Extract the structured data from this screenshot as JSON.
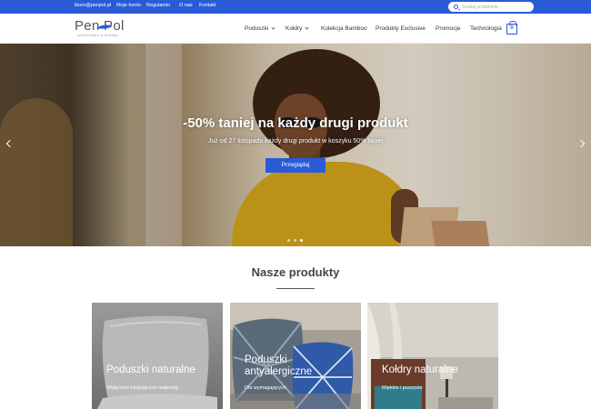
{
  "topbar": {
    "links": [
      "biuro@penpol.pl",
      "Moje konto",
      "Regulamin",
      "O nas",
      "Kontakt"
    ],
    "search_placeholder": "Szukaj produktów..."
  },
  "header": {
    "logo_text": "Pen  Pol",
    "logo_tagline": "comfortable & healthy",
    "nav": [
      {
        "label": "Poduszki",
        "has_dropdown": true
      },
      {
        "label": "Kołdry",
        "has_dropdown": true
      },
      {
        "label": "Kolekcja Bamboo",
        "has_dropdown": false
      },
      {
        "label": "Produkty Exclusive",
        "has_dropdown": false
      },
      {
        "label": "Promocje",
        "has_dropdown": false
      },
      {
        "label": "Technologia",
        "has_dropdown": false
      }
    ],
    "cart_count": "0"
  },
  "hero": {
    "title": "-50% taniej na każdy drugi produkt",
    "subtitle": "Już od 27 listopada każdy drugi produkt w koszyku 50% taniej",
    "button_label": "Przeglądaj",
    "slides": 3,
    "active_slide": 3
  },
  "products": {
    "title": "Nasze produkty",
    "cards": [
      {
        "name": "Poduszki naturalne",
        "description": "Wyłącznie ekologiczne materiały"
      },
      {
        "name": "Poduszki antyalergiczne",
        "name_lines": [
          "Poduszki",
          "antyalergiczne"
        ],
        "description": "Dla wymagających"
      },
      {
        "name": "Kołdry naturalne",
        "description": "Miękkie i puszyste"
      }
    ]
  },
  "colors": {
    "accent": "#2a5bd7",
    "text": "#333333"
  }
}
